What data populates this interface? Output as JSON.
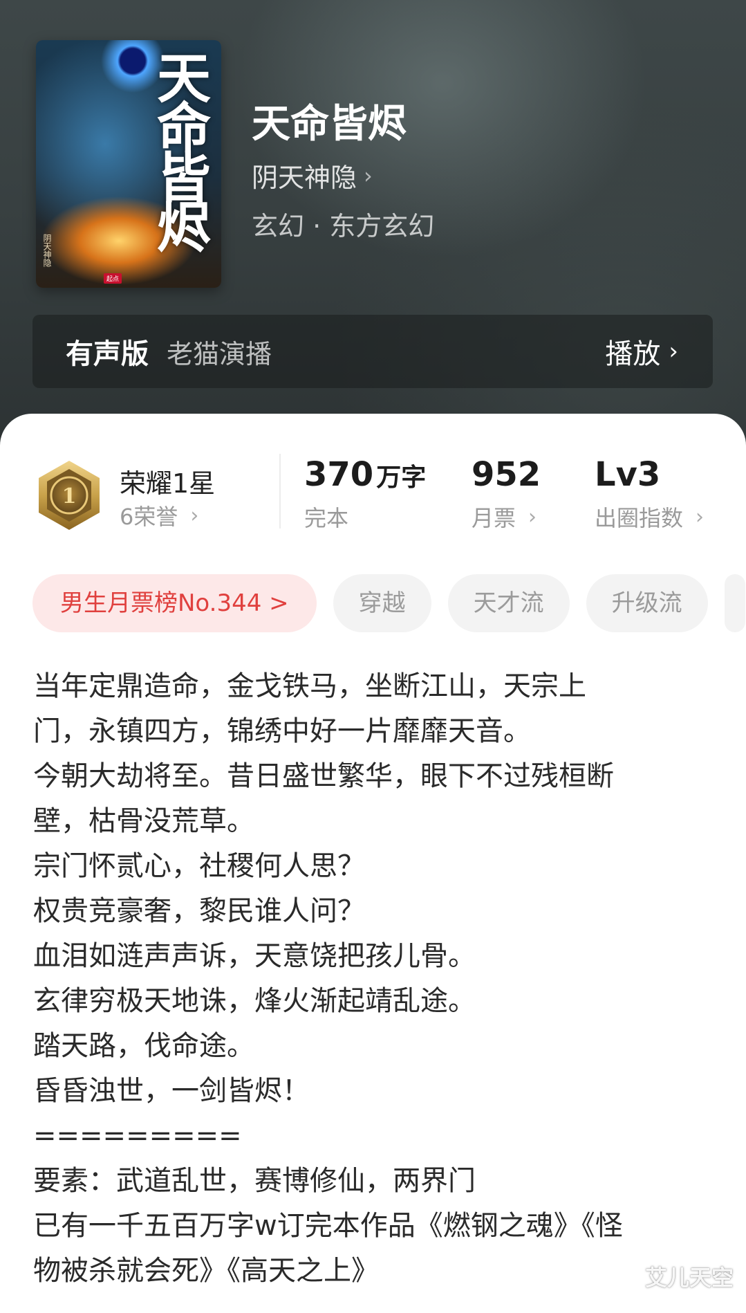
{
  "book": {
    "title": "天命皆烬",
    "author": "阴天神隐",
    "genre": "玄幻 · 东方玄幻",
    "cover_title": "天命皆烬"
  },
  "audio": {
    "label": "有声版",
    "narrator": "老猫演播",
    "play_label": "播放"
  },
  "honor": {
    "title": "荣耀1星",
    "subtitle": "6荣誉",
    "medal_number": "1"
  },
  "stats": [
    {
      "value": "370",
      "unit": "万字",
      "label": "完本"
    },
    {
      "value": "952",
      "unit": "",
      "label": "月票"
    },
    {
      "value": "Lv3",
      "unit": "",
      "label": "出圈指数"
    }
  ],
  "tags": {
    "rank": "男生月票榜No.344 >",
    "items": [
      "穿越",
      "天才流",
      "升级流"
    ]
  },
  "description": [
    "当年定鼎造命，金戈铁马，坐断江山，天宗上",
    "门，永镇四方，锦绣中好一片靡靡天音。",
    "今朝大劫将至。昔日盛世繁华，眼下不过残桓断",
    "壁，枯骨没荒草。",
    "宗门怀贰心，社稷何人思？",
    "权贵竞豪奢，黎民谁人问？",
    "血泪如涟声声诉，天意饶把孩儿骨。",
    "玄律穷极天地诛，烽火渐起靖乱途。",
    "踏天路，伐命途。",
    "昏昏浊世，一剑皆烬！",
    "=========",
    "要素：武道乱世，赛博修仙，两界门",
    "已有一千五百万字w订完本作品《燃钢之魂》《怪",
    "物被杀就会死》《高天之上》"
  ],
  "watermark": "艾儿天空",
  "colors": {
    "rank_tag_bg": "#fde8e8",
    "rank_tag_text": "#e0403e",
    "tag_bg": "#f3f3f3",
    "medal_gold": "#c9a24a"
  }
}
